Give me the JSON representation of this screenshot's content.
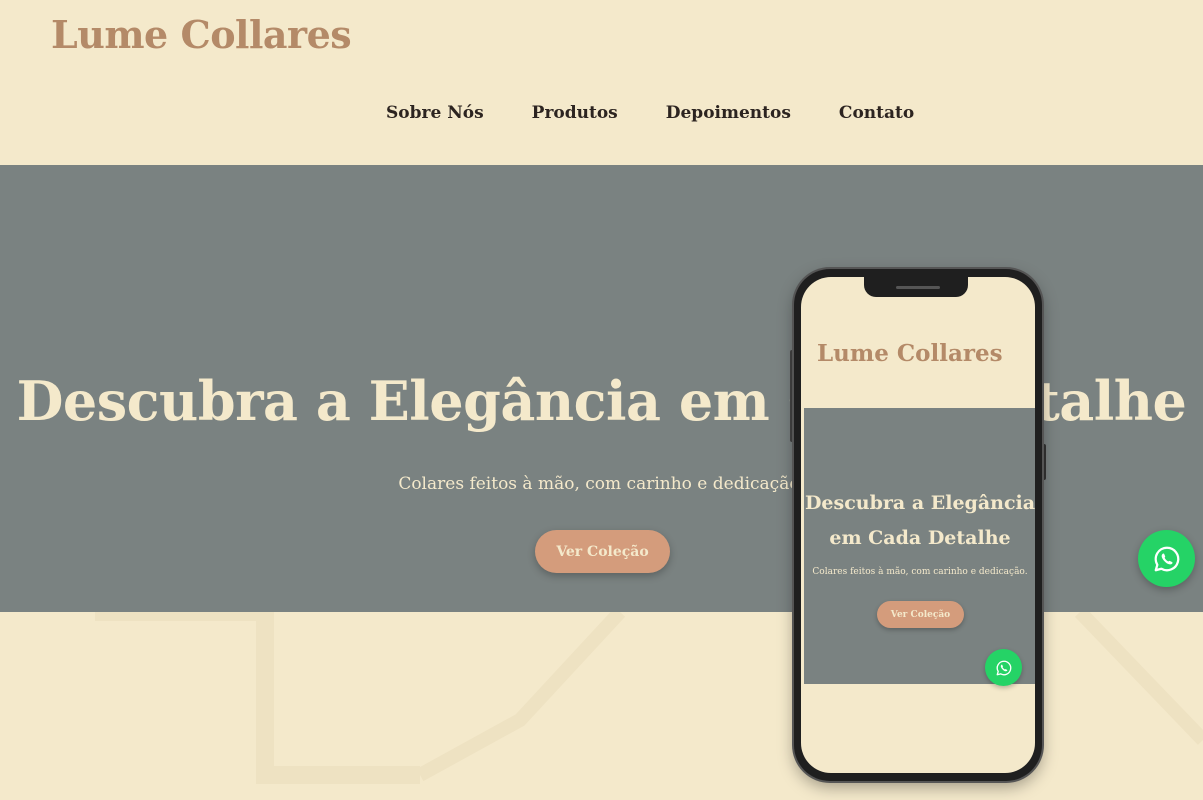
{
  "brand": {
    "name": "Lume Collares"
  },
  "nav": {
    "items": [
      {
        "label": "Sobre Nós"
      },
      {
        "label": "Produtos"
      },
      {
        "label": "Depoimentos"
      },
      {
        "label": "Contato"
      }
    ]
  },
  "hero": {
    "title": "Descubra a Elegância em Cada Detalhe",
    "subtitle": "Colares feitos à mão, com carinho e dedicação.",
    "cta_label": "Ver Coleção"
  },
  "mobile": {
    "brand": "Lume Collares",
    "title": "Descubra a Elegância em Cada Detalhe",
    "subtitle": "Colares feitos à mão, com carinho e dedicação.",
    "cta_label": "Ver Coleção"
  },
  "icons": {
    "whatsapp": "whatsapp-icon"
  },
  "colors": {
    "background": "#f4e9cb",
    "hero": "#7a8281",
    "brand": "#b48a68",
    "cta": "#d49c7c",
    "whatsapp": "#25d366"
  }
}
